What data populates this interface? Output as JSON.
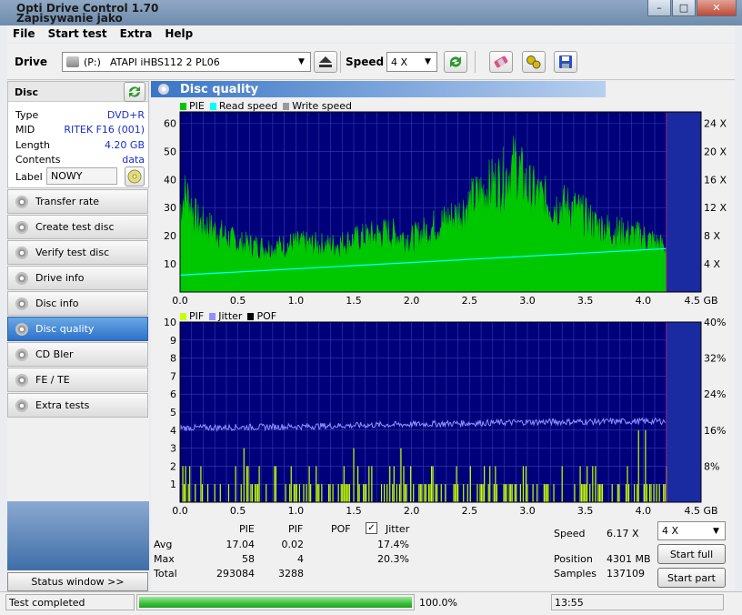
{
  "window": {
    "title": "Opti Drive Control 1.70",
    "subtitle": "Zapisywanie jako"
  },
  "menu": {
    "file": "File",
    "start_test": "Start test",
    "extra": "Extra",
    "help": "Help"
  },
  "toolbar": {
    "drive_label": "Drive",
    "drive_letter": "(P:)",
    "drive_value": "ATAPI  iHBS112   2 PL06",
    "speed_label": "Speed",
    "speed_value": "4 X"
  },
  "disc": {
    "header": "Disc",
    "type_label": "Type",
    "type_value": "DVD+R",
    "mid_label": "MID",
    "mid_value": "RITEK F16 (001)",
    "length_label": "Length",
    "length_value": "4.20 GB",
    "contents_label": "Contents",
    "contents_value": "data",
    "label_label": "Label",
    "label_value": "NOWY"
  },
  "nav": [
    "Transfer rate",
    "Create test disc",
    "Verify test disc",
    "Drive info",
    "Disc info",
    "Disc quality",
    "CD Bler",
    "FE / TE",
    "Extra tests"
  ],
  "nav_active": 5,
  "status_window_button": "Status window >>",
  "panel_title": "Disc quality",
  "legend_top": {
    "pie": "PIE",
    "read": "Read speed",
    "write": "Write speed"
  },
  "legend_bottom": {
    "pif": "PIF",
    "jitter": "Jitter",
    "pof": "POF"
  },
  "colors": {
    "pie": "#00c800",
    "read_speed": "#00ffff",
    "write_speed": "#9a9a9a",
    "pif": "#c8ff00",
    "jitter": "#9090ff",
    "pof": "#000000",
    "plot_bg": "#00007a",
    "grid": "#3a3ab0",
    "end_marker": "#a02080"
  },
  "chart_data": [
    {
      "type": "bar",
      "name": "PIE / Read speed",
      "x_range": [
        0,
        4.5
      ],
      "x_unit": "GB",
      "x_ticks": [
        "0.0",
        "0.5",
        "1.0",
        "1.5",
        "2.0",
        "2.5",
        "3.0",
        "3.5",
        "4.0",
        "4.5 GB"
      ],
      "ylim": [
        0,
        64
      ],
      "y_ticks_left": [
        "10",
        "20",
        "30",
        "40",
        "50",
        "60"
      ],
      "y_ticks_right": [
        "4 X",
        "8 X",
        "12 X",
        "16 X",
        "20 X",
        "24 X"
      ],
      "right_axis_range": [
        0,
        24
      ],
      "disc_end_gb": 4.2,
      "pie_envelope": [
        {
          "x": 0.0,
          "y": 38
        },
        {
          "x": 0.05,
          "y": 45
        },
        {
          "x": 0.15,
          "y": 32
        },
        {
          "x": 0.3,
          "y": 28
        },
        {
          "x": 0.5,
          "y": 22
        },
        {
          "x": 0.8,
          "y": 20
        },
        {
          "x": 1.0,
          "y": 22
        },
        {
          "x": 1.3,
          "y": 21
        },
        {
          "x": 1.6,
          "y": 25
        },
        {
          "x": 1.8,
          "y": 27
        },
        {
          "x": 2.0,
          "y": 24
        },
        {
          "x": 2.2,
          "y": 30
        },
        {
          "x": 2.4,
          "y": 35
        },
        {
          "x": 2.6,
          "y": 45
        },
        {
          "x": 2.8,
          "y": 52
        },
        {
          "x": 2.9,
          "y": 58
        },
        {
          "x": 3.0,
          "y": 47
        },
        {
          "x": 3.2,
          "y": 40
        },
        {
          "x": 3.4,
          "y": 38
        },
        {
          "x": 3.6,
          "y": 30
        },
        {
          "x": 3.8,
          "y": 27
        },
        {
          "x": 4.0,
          "y": 25
        },
        {
          "x": 4.2,
          "y": 20
        }
      ],
      "read_speed": [
        {
          "x": 0.0,
          "y": 2.4
        },
        {
          "x": 4.2,
          "y": 6.17
        }
      ]
    },
    {
      "type": "bar",
      "name": "PIF / Jitter",
      "x_range": [
        0,
        4.5
      ],
      "x_ticks": [
        "0.0",
        "0.5",
        "1.0",
        "1.5",
        "2.0",
        "2.5",
        "3.0",
        "3.5",
        "4.0",
        "4.5 GB"
      ],
      "ylim": [
        0,
        10
      ],
      "y_ticks_left": [
        "1",
        "2",
        "3",
        "4",
        "5",
        "6",
        "7",
        "8",
        "9",
        "10"
      ],
      "y_ticks_right": [
        "8%",
        "16%",
        "24%",
        "32%",
        "40%"
      ],
      "right_axis_range": [
        0,
        40
      ],
      "disc_end_gb": 4.2,
      "jitter": [
        {
          "x": 0.0,
          "y": 16.5
        },
        {
          "x": 1.0,
          "y": 16.8
        },
        {
          "x": 2.0,
          "y": 17.3
        },
        {
          "x": 3.0,
          "y": 17.8
        },
        {
          "x": 4.2,
          "y": 18.0
        }
      ],
      "pif_max": 4
    }
  ],
  "stats": {
    "col_pie": "PIE",
    "col_pif": "PIF",
    "col_pof": "POF",
    "col_jitter": "Jitter",
    "avg_label": "Avg",
    "max_label": "Max",
    "total_label": "Total",
    "avg_pie": "17.04",
    "avg_pif": "0.02",
    "avg_jitter": "17.4%",
    "max_pie": "58",
    "max_pif": "4",
    "max_jitter": "20.3%",
    "total_pie": "293084",
    "total_pif": "3288",
    "jitter_checked": true
  },
  "info": {
    "speed_label": "Speed",
    "speed_value": "6.17 X",
    "position_label": "Position",
    "position_value": "4301 MB",
    "samples_label": "Samples",
    "samples_value": "137109",
    "speed_select": "4 X",
    "start_full": "Start full",
    "start_part": "Start part"
  },
  "statusbar": {
    "text": "Test completed",
    "progress_text": "100.0%",
    "progress": 1.0,
    "time": "13:55"
  }
}
